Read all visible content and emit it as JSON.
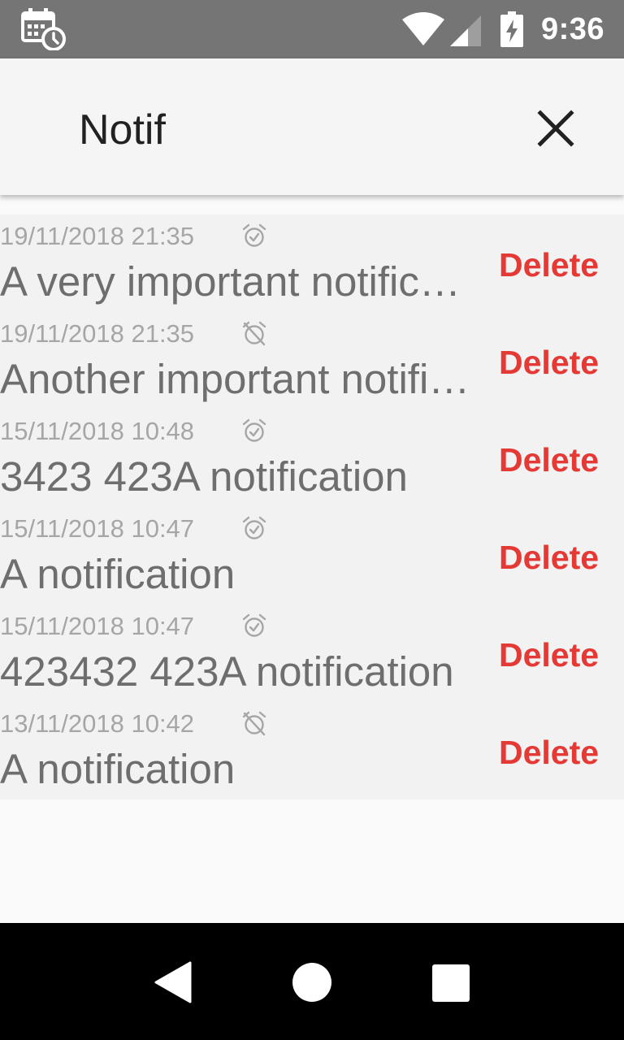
{
  "status_bar": {
    "time": "9:36",
    "left_icon": "calendar-clock-icon",
    "wifi_icon": "wifi-icon",
    "signal_icon": "cell-signal-icon",
    "battery_icon": "battery-charging-icon"
  },
  "app_bar": {
    "title": "Notif",
    "close_icon": "close-icon"
  },
  "notifications": [
    {
      "date": "19/11/2018 21:35",
      "alarm": "alarm-on-icon",
      "title": "A very important notification",
      "delete_label": "Delete"
    },
    {
      "date": "19/11/2018 21:35",
      "alarm": "alarm-off-icon",
      "title": "Another important notification",
      "delete_label": "Delete"
    },
    {
      "date": "15/11/2018 10:48",
      "alarm": "alarm-on-icon",
      "title": "3423 423A notification",
      "delete_label": "Delete"
    },
    {
      "date": "15/11/2018 10:47",
      "alarm": "alarm-on-icon",
      "title": "A notification",
      "delete_label": "Delete"
    },
    {
      "date": "15/11/2018 10:47",
      "alarm": "alarm-on-icon",
      "title": "423432 423A notification",
      "delete_label": "Delete"
    },
    {
      "date": "13/11/2018 10:42",
      "alarm": "alarm-off-icon",
      "title": "A notification",
      "delete_label": "Delete"
    }
  ],
  "nav_bar": {
    "back_icon": "back-triangle-icon",
    "home_icon": "home-circle-icon",
    "recents_icon": "recents-square-icon"
  },
  "colors": {
    "status_bar": "#757575",
    "app_bar": "#f5f5f5",
    "list_bg": "#f2f2f2",
    "delete": "#e53935",
    "date_text": "#a6a6a6",
    "title_text": "#6e6e6e"
  }
}
